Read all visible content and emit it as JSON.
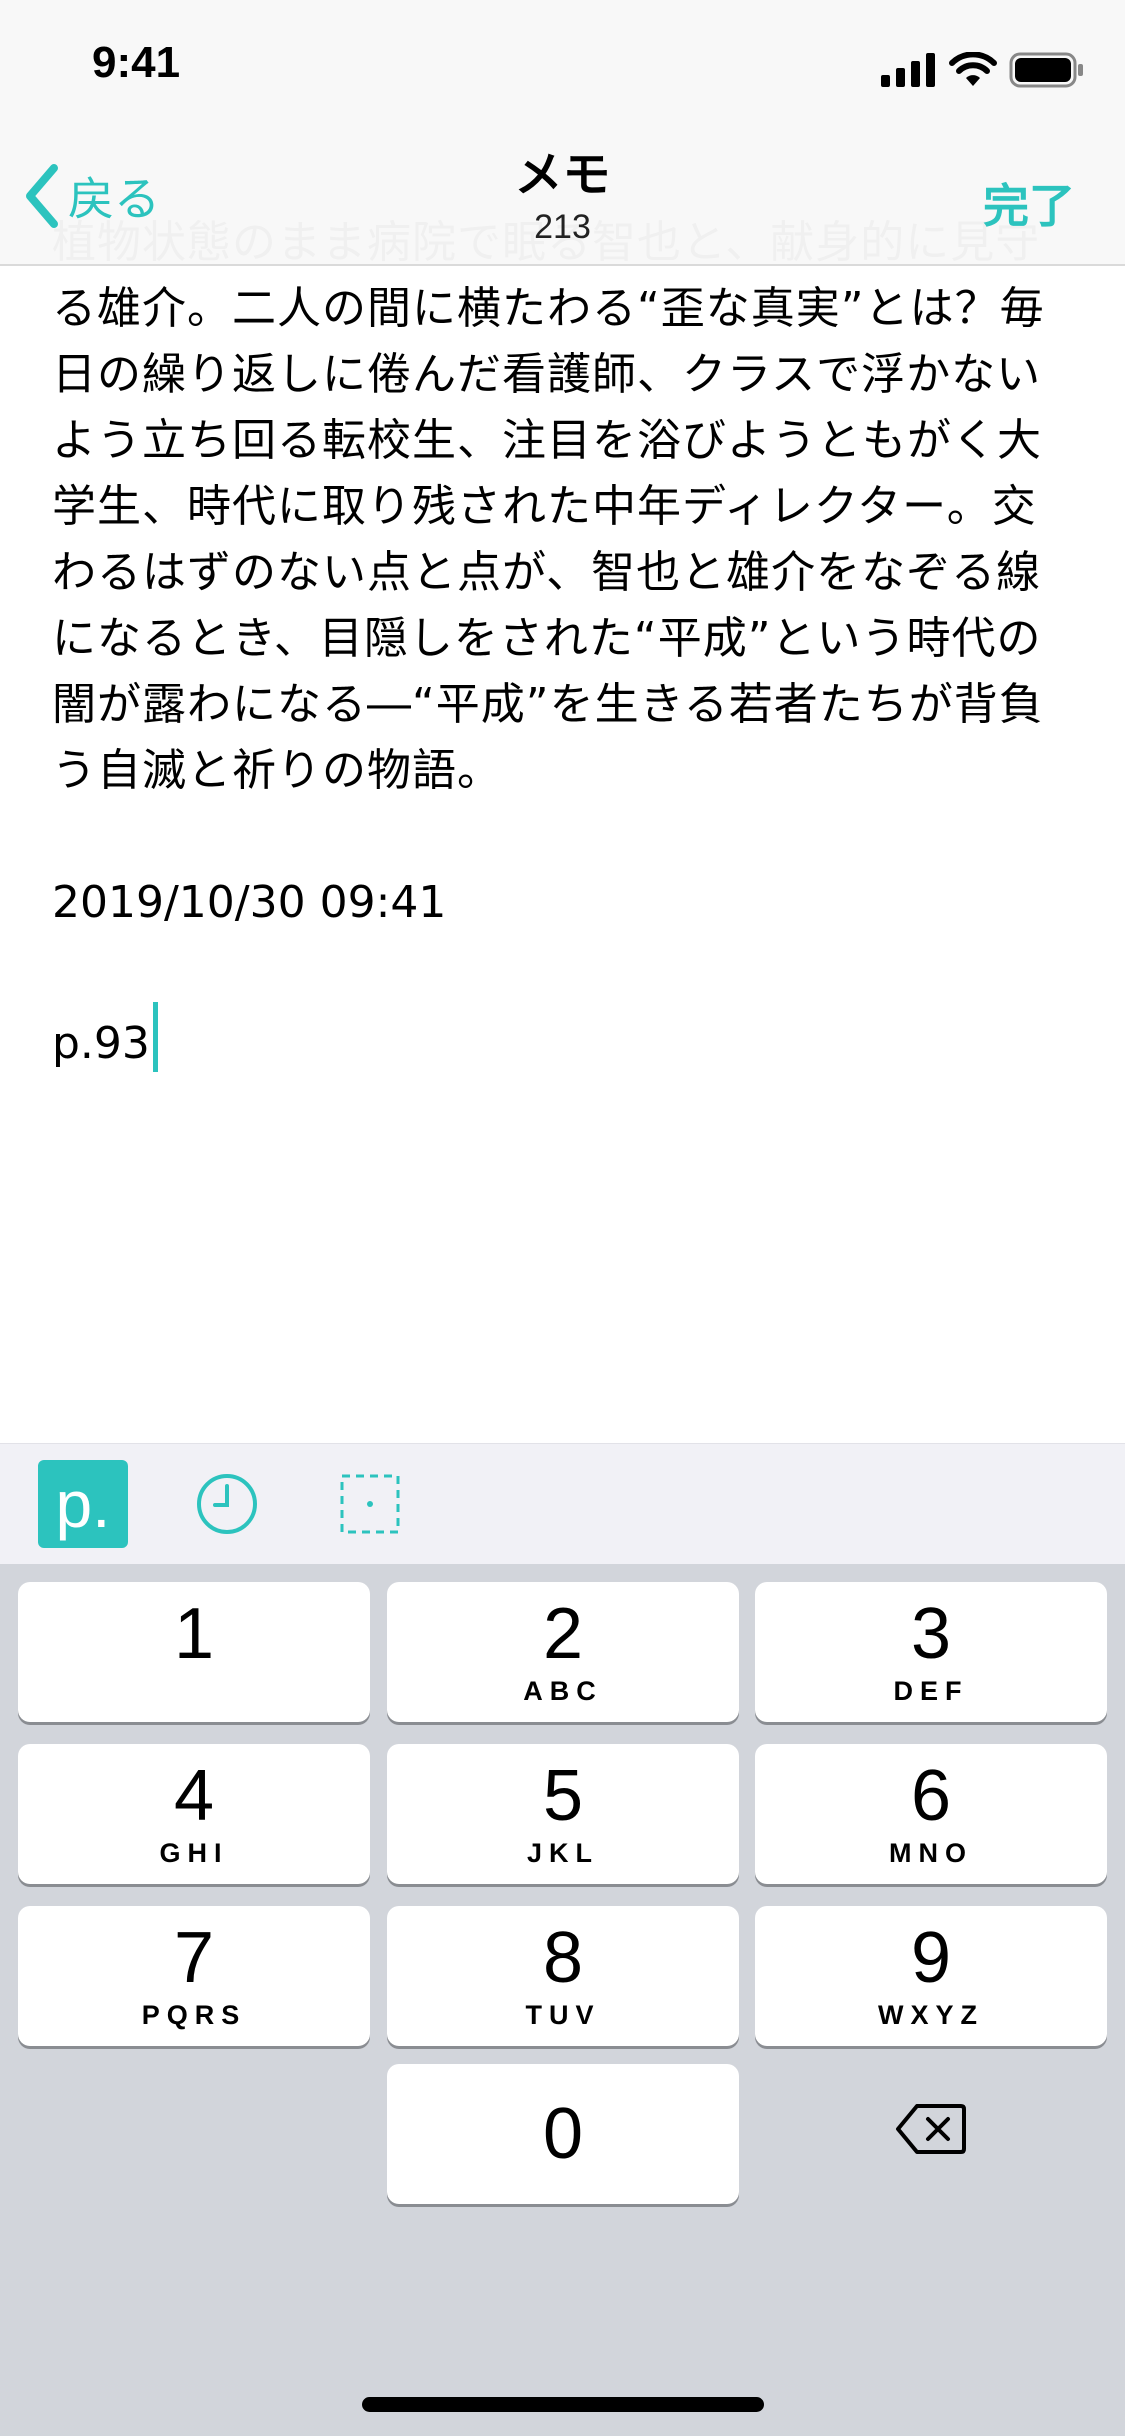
{
  "status_bar": {
    "time": "9:41"
  },
  "nav": {
    "back_label": "戻る",
    "title": "メモ",
    "char_count": "213",
    "done_label": "完了"
  },
  "memo": {
    "paragraph": "植物状態のまま病院で眠る智也と、献身的に見守る雄介。二人の間に横たわる“歪な真実”とは？毎日の繰り返しに倦んだ看護師、クラスで浮かないよう立ち回る転校生、注目を浴びようともがく大学生、時代に取り残された中年ディレクター。交わるはずのない点と点が、智也と雄介をなぞる線になるとき、目隠しをされた“平成”という時代の闇が露わになる―“平成”を生きる若者たちが背負う自滅と祈りの物語。",
    "timestamp": "2019/10/30 09:41",
    "page_ref": "p.93"
  },
  "toolbar": {
    "page_button_label": "p.",
    "icons": [
      "page-insert-icon",
      "clock-icon",
      "dotted-frame-icon"
    ]
  },
  "keyboard": {
    "keys": [
      {
        "num": "1",
        "letters": ""
      },
      {
        "num": "2",
        "letters": "ABC"
      },
      {
        "num": "3",
        "letters": "DEF"
      },
      {
        "num": "4",
        "letters": "GHI"
      },
      {
        "num": "5",
        "letters": "JKL"
      },
      {
        "num": "6",
        "letters": "MNO"
      },
      {
        "num": "7",
        "letters": "PQRS"
      },
      {
        "num": "8",
        "letters": "TUV"
      },
      {
        "num": "9",
        "letters": "WXYZ"
      },
      {
        "num": "0",
        "letters": ""
      }
    ]
  },
  "colors": {
    "accent": "#2cc3be",
    "keyboard_background": "#d2d5db",
    "toolbar_background": "#f1f1f6"
  }
}
